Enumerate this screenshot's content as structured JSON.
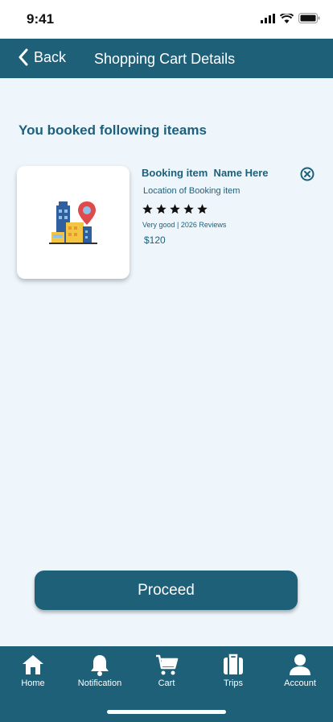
{
  "status": {
    "time": "9:41"
  },
  "header": {
    "back_label": "Back",
    "title": "Shopping Cart Details"
  },
  "section": {
    "title": "You booked following iteams"
  },
  "item": {
    "name": "Booking item  Name Here",
    "location": "Location of Booking item",
    "rating_stars": 5,
    "reviews": "Very good | 2026 Reviews",
    "price": "$120"
  },
  "proceed": {
    "label": "Proceed"
  },
  "nav": {
    "items": [
      {
        "label": "Home",
        "icon": "home-icon"
      },
      {
        "label": "Notification",
        "icon": "bell-icon"
      },
      {
        "label": "Cart",
        "icon": "cart-icon"
      },
      {
        "label": "Trips",
        "icon": "briefcase-icon"
      },
      {
        "label": "Account",
        "icon": "user-icon"
      }
    ]
  },
  "colors": {
    "primary": "#1f6079",
    "background": "#eef6fc",
    "text": "#1e5f7a"
  }
}
